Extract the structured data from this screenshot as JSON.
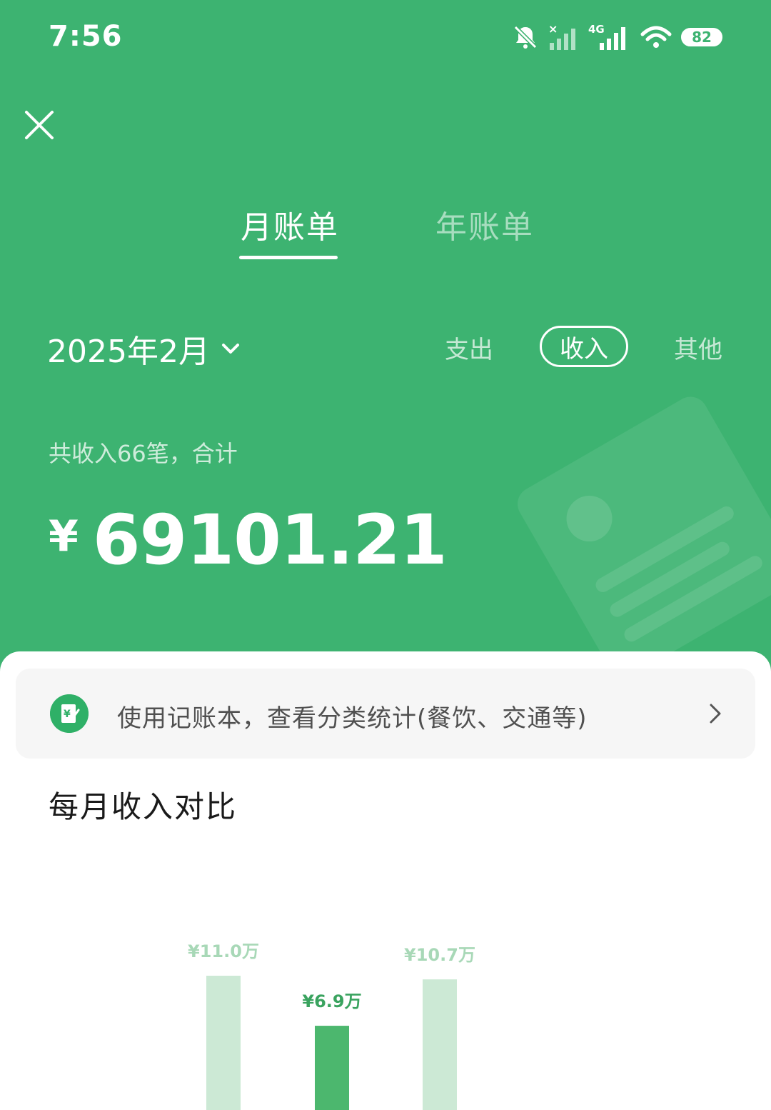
{
  "status_bar": {
    "time": "7:56",
    "battery": "82",
    "network": "4G"
  },
  "tabs": {
    "monthly": "月账单",
    "yearly": "年账单"
  },
  "period": {
    "label": "2025年2月"
  },
  "filters": {
    "expense": "支出",
    "income": "收入",
    "other": "其他",
    "selected": "收入"
  },
  "summary": {
    "text": "共收入66笔，合计",
    "currency": "¥",
    "amount": "69101.21"
  },
  "promo": {
    "text": "使用记账本，查看分类统计(餐饮、交通等)"
  },
  "section": {
    "title": "每月收入对比"
  },
  "colors": {
    "brand": "#3db371",
    "bar_light": "#cce9d5",
    "bar_active": "#4cb76e",
    "label_light": "#a8d8b7",
    "label_active": "#3aa35f"
  },
  "chart_data": {
    "type": "bar",
    "title": "每月收入对比",
    "unit": "万",
    "values": [
      11.0,
      6.9,
      10.7
    ],
    "labels": [
      "¥11.0万",
      "¥6.9万",
      "¥10.7万"
    ],
    "highlight_index": 1
  }
}
